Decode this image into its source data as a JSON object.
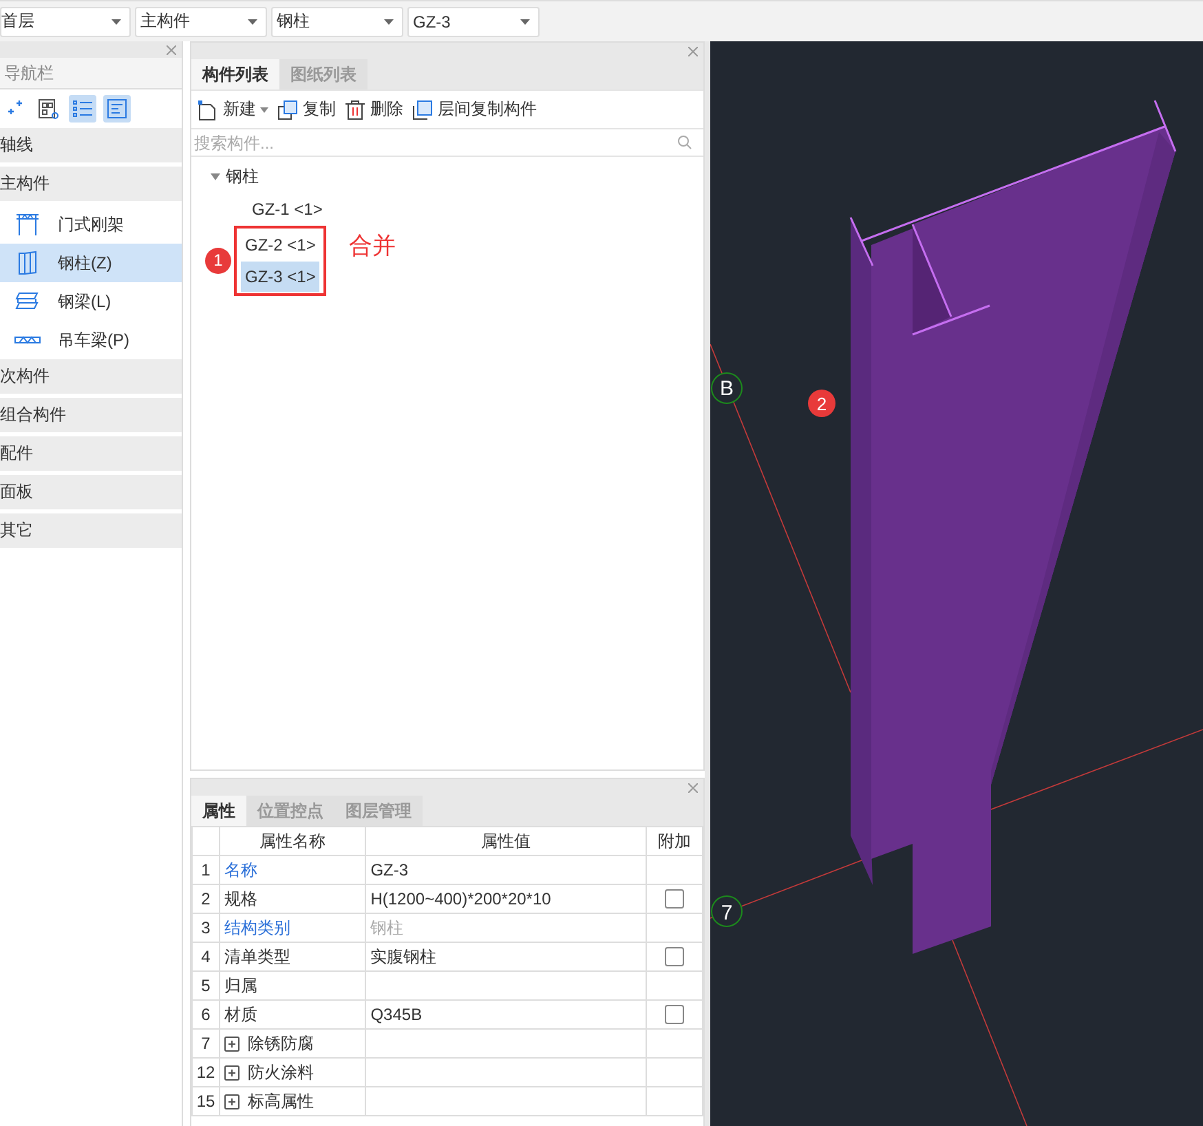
{
  "top_bar": {
    "dropdowns": [
      "首层",
      "主构件",
      "钢柱",
      "GZ-3"
    ]
  },
  "nav": {
    "title": "导航栏",
    "tools": [
      {
        "kind": "add",
        "selected": false
      },
      {
        "kind": "grid",
        "selected": false
      },
      {
        "kind": "list",
        "selected": true
      },
      {
        "kind": "detail",
        "selected": true
      }
    ],
    "groups": [
      {
        "label": "轴线"
      },
      {
        "label": "主构件",
        "items": [
          {
            "label": "门式刚架",
            "kind": "frame",
            "selected": false
          },
          {
            "label": "钢柱(Z)",
            "kind": "column",
            "selected": true
          },
          {
            "label": "钢梁(L)",
            "kind": "beam",
            "selected": false
          },
          {
            "label": "吊车梁(P)",
            "kind": "crane",
            "selected": false
          }
        ]
      },
      {
        "label": "次构件"
      },
      {
        "label": "组合构件"
      },
      {
        "label": "配件"
      },
      {
        "label": "面板"
      },
      {
        "label": "其它"
      }
    ]
  },
  "component_panel": {
    "tabs": [
      {
        "label": "构件列表",
        "selected": true
      },
      {
        "label": "图纸列表",
        "selected": false
      }
    ],
    "toolbar": [
      {
        "kind": "new",
        "label": "新建"
      },
      {
        "kind": "copy",
        "label": "复制"
      },
      {
        "kind": "delete",
        "label": "删除"
      },
      {
        "kind": "floor_copy",
        "label": "层间复制构件"
      }
    ],
    "search": {
      "placeholder": "搜索构件..."
    },
    "tree": {
      "label": "钢柱",
      "expanded": true,
      "children": [
        {
          "label": "GZ-1 <1>",
          "selected": false
        },
        {
          "label": "GZ-2 <1>",
          "selected": false
        },
        {
          "label": "GZ-3 <1>",
          "selected": true
        }
      ]
    },
    "annotation": {
      "badge": "1",
      "note": "合并"
    }
  },
  "properties": {
    "tabs": [
      {
        "label": "属性",
        "selected": true
      },
      {
        "label": "位置控点",
        "selected": false
      },
      {
        "label": "图层管理",
        "selected": false
      }
    ],
    "columns": [
      "属性名称",
      "属性值",
      "附加"
    ],
    "rows": [
      {
        "no": "1",
        "name": "名称",
        "value": "GZ-3",
        "link": true,
        "disabled": false,
        "kind": "plain"
      },
      {
        "no": "2",
        "name": "规格",
        "value": "H(1200~400)*200*20*10",
        "link": false,
        "disabled": false,
        "kind": "plain",
        "checked": false
      },
      {
        "no": "3",
        "name": "结构类别",
        "value": "钢柱",
        "link": true,
        "disabled": true,
        "kind": "plain"
      },
      {
        "no": "4",
        "name": "清单类型",
        "value": "实腹钢柱",
        "link": false,
        "disabled": false,
        "kind": "plain",
        "checked": false
      },
      {
        "no": "5",
        "name": "归属",
        "link": false,
        "kind": "plain"
      },
      {
        "no": "6",
        "name": "材质",
        "value": "Q345B",
        "link": false,
        "disabled": false,
        "kind": "plain",
        "checked": false
      },
      {
        "no": "7",
        "name": "除锈防腐",
        "kind": "group"
      },
      {
        "no": "12",
        "name": "防火涂料",
        "kind": "group"
      },
      {
        "no": "15",
        "name": "标高属性",
        "kind": "group"
      }
    ]
  },
  "viewport": {
    "axis_labels": [
      "B",
      "7"
    ],
    "badge": "2"
  }
}
